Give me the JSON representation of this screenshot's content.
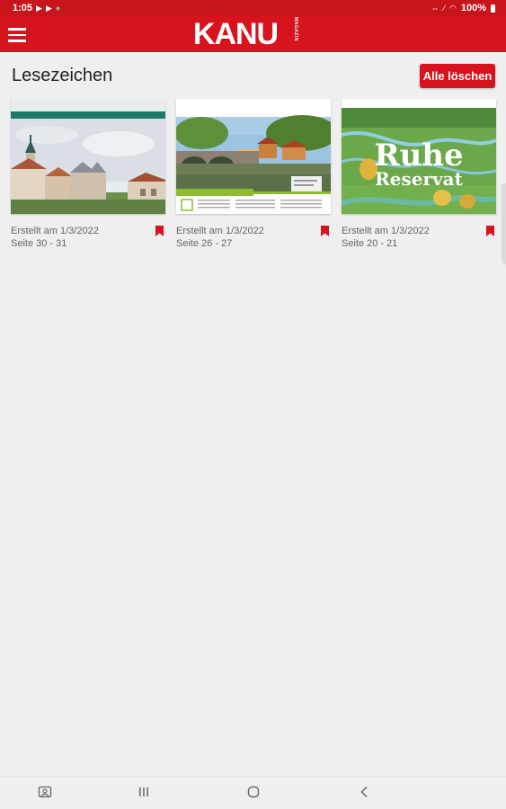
{
  "status": {
    "time": "1:05",
    "battery": "100%"
  },
  "app": {
    "brand": "KANU",
    "brand_sub": "MAGAZIN"
  },
  "page": {
    "title": "Lesezeichen",
    "clear_all_label": "Alle löschen"
  },
  "bookmarks": [
    {
      "created": "Erstellt am 1/3/2022",
      "pages": "Seite 30 - 31",
      "thumbnail": "town-with-castle"
    },
    {
      "created": "Erstellt am 1/3/2022",
      "pages": "Seite 26 - 27",
      "thumbnail": "stone-bridge-river"
    },
    {
      "created": "Erstellt am 1/3/2022",
      "pages": "Seite 20 - 21",
      "thumbnail": "river-meadow-ruhe-reservat",
      "cover_title_1": "Ruhe",
      "cover_title_2": "Reservat"
    }
  ],
  "colors": {
    "brand_red": "#d7131d",
    "status_red": "#c8151c",
    "background": "#efefef"
  },
  "nav": [
    "recent-apps-icon",
    "home-icon",
    "back-icon",
    "screenshot-icon"
  ]
}
